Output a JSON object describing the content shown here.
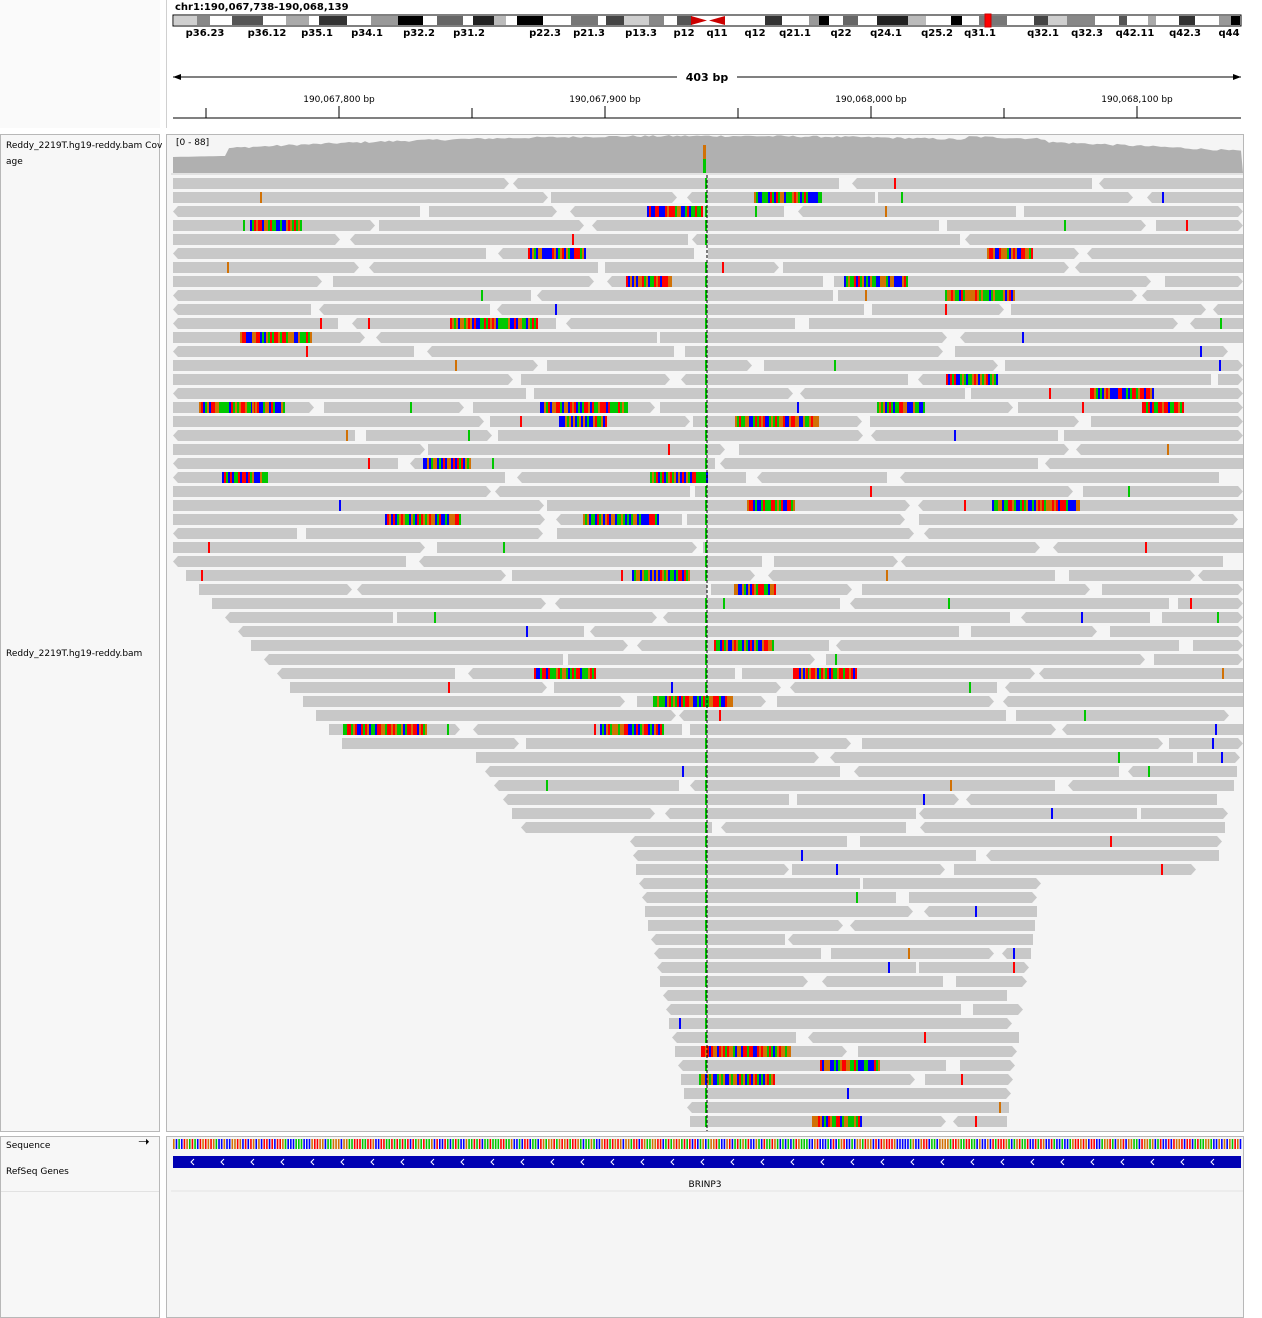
{
  "header": {
    "locus": "chr1:190,067,738-190,068,139",
    "span_label": "403 bp"
  },
  "ideogram": {
    "bands": [
      "p36.23",
      "p36.12",
      "p35.1",
      "p34.1",
      "p32.2",
      "p31.2",
      "p22.3",
      "p21.3",
      "p13.3",
      "p12",
      "q11",
      "q12",
      "q21.1",
      "q22",
      "q24.1",
      "q25.2",
      "q31.1",
      "q32.1",
      "q32.3",
      "q42.11",
      "q42.3",
      "q44"
    ]
  },
  "ruler": {
    "ticks": [
      "190,067,800 bp",
      "190,067,900 bp",
      "190,068,000 bp",
      "190,068,100 bp"
    ]
  },
  "tracks": {
    "coverage_name_line1": "Reddy_2219T.hg19-reddy.bam Cov",
    "coverage_name_line2": "age",
    "coverage_range": "[0 - 88]",
    "alignment_name": "Reddy_2219T.hg19-reddy.bam",
    "sequence_name": "Sequence",
    "refseq_name": "RefSeq Genes",
    "gene_label": "BRINP3"
  },
  "colors": {
    "read": "#c8c8c8",
    "coverage": "#b0b0b0",
    "gene": "#0000b2",
    "base_A": "#00c800",
    "base_C": "#0000ff",
    "base_G": "#d17105",
    "base_T": "#ff0000",
    "centromere": "#cc0000"
  }
}
